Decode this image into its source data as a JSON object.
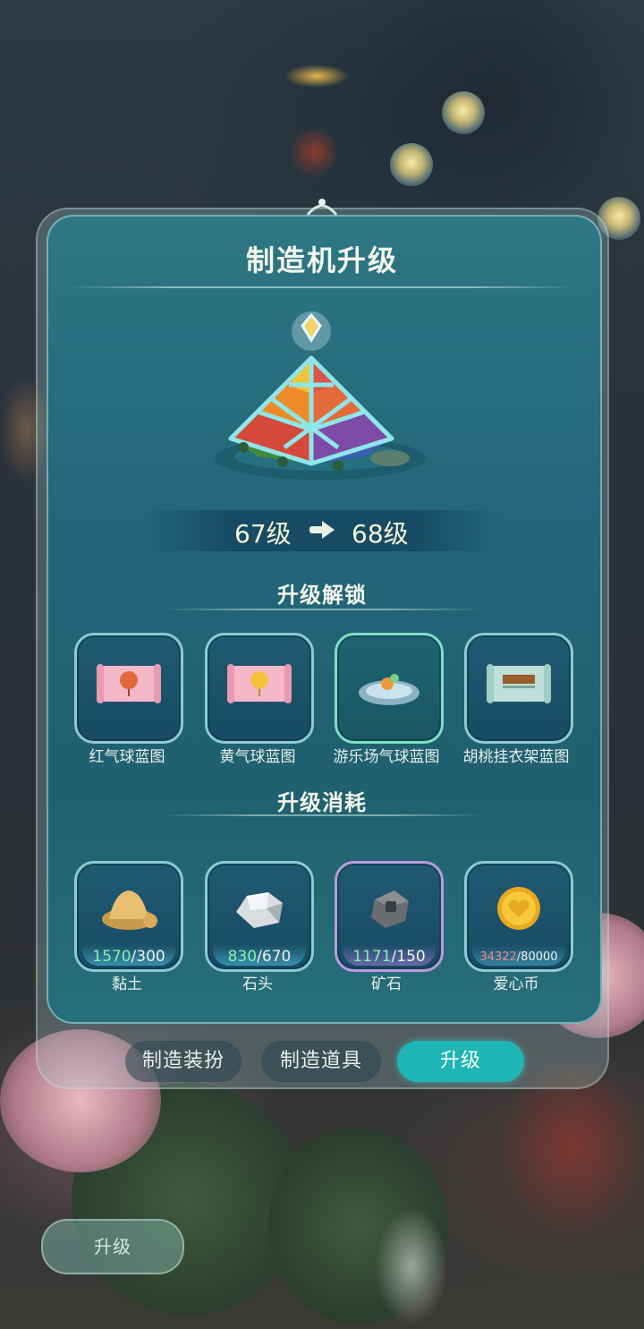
{
  "panel": {
    "title": "制造机升级",
    "level_from": "67级",
    "level_to": "68级"
  },
  "unlock": {
    "title": "升级解锁",
    "items": [
      {
        "label": "红气球蓝图",
        "icon": "red-balloon-blueprint-icon"
      },
      {
        "label": "黄气球蓝图",
        "icon": "yellow-balloon-blueprint-icon"
      },
      {
        "label": "游乐场气球蓝图",
        "icon": "playground-balloon-blueprint-icon"
      },
      {
        "label": "胡桃挂衣架蓝图",
        "icon": "walnut-coat-rack-blueprint-icon"
      }
    ]
  },
  "cost": {
    "title": "升级消耗",
    "items": [
      {
        "label": "黏土",
        "have": "1570",
        "need": "/300",
        "icon": "clay-icon"
      },
      {
        "label": "石头",
        "have": "830",
        "need": "/670",
        "icon": "stone-icon"
      },
      {
        "label": "矿石",
        "have": "1171",
        "need": "/150",
        "icon": "ore-icon"
      },
      {
        "label": "爱心币",
        "have": "34322",
        "need": "/80000",
        "icon": "heart-coin-icon"
      }
    ]
  },
  "tabs": [
    "制造装扮",
    "制造道具",
    "升级"
  ],
  "active_tab": "升级",
  "bottom_button": "升级",
  "colors": {
    "panel": "#24677a",
    "active_tab": "#1fb5b5",
    "enough": "#86f0ad",
    "not_enough": "#f08a8a"
  }
}
